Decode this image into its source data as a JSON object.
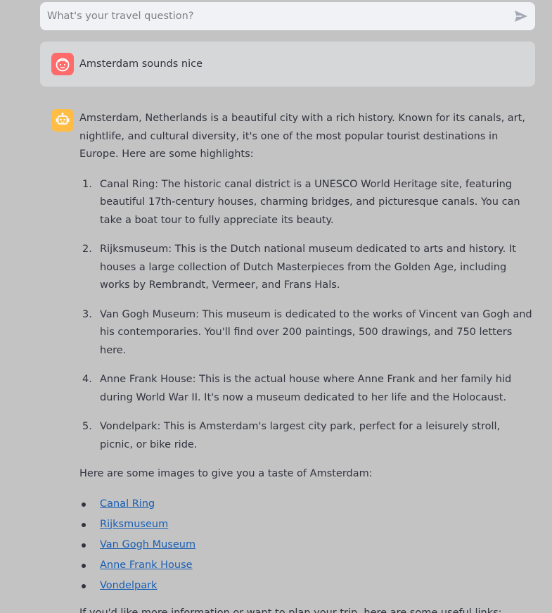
{
  "chat_input": {
    "placeholder": "What's your travel question?",
    "send_icon": "send-icon"
  },
  "user_message": {
    "avatar_icon": "user-face-icon",
    "avatar_color": "#ff6b6b",
    "text": "Amsterdam sounds nice"
  },
  "assistant_message": {
    "avatar_icon": "robot-icon",
    "avatar_color": "#ffbd45",
    "intro": "Amsterdam, Netherlands is a beautiful city with a rich history. Known for its canals, art, nightlife, and cultural diversity, it's one of the most popular tourist destinations in Europe. Here are some highlights:",
    "highlights": [
      {
        "num": "1.",
        "text": "Canal Ring: The historic canal district is a UNESCO World Heritage site, featuring beautiful 17th-century houses, charming bridges, and picturesque canals. You can take a boat tour to fully appreciate its beauty."
      },
      {
        "num": "2.",
        "text": "Rijksmuseum: This is the Dutch national museum dedicated to arts and history. It houses a large collection of Dutch Masterpieces from the Golden Age, including works by Rembrandt, Vermeer, and Frans Hals."
      },
      {
        "num": "3.",
        "text": "Van Gogh Museum: This museum is dedicated to the works of Vincent van Gogh and his contemporaries. You'll find over 200 paintings, 500 drawings, and 750 letters here."
      },
      {
        "num": "4.",
        "text": "Anne Frank House: This is the actual house where Anne Frank and her family hid during World War II. It's now a museum dedicated to her life and the Holocaust."
      },
      {
        "num": "5.",
        "text": "Vondelpark: This is Amsterdam's largest city park, perfect for a leisurely stroll, picnic, or bike ride."
      }
    ],
    "images_intro": "Here are some images to give you a taste of Amsterdam:",
    "image_links": [
      "Canal Ring",
      "Rijksmuseum",
      "Van Gogh Museum",
      "Anne Frank House",
      "Vondelpark"
    ],
    "outro": "If you'd like more information or want to plan your trip, here are some useful links:"
  },
  "colors": {
    "background": "#c3c3c3",
    "input_bg": "#f0f2f6",
    "user_bubble_bg": "#d6d7d8",
    "link": "#1a5fb4",
    "text": "#31333f"
  }
}
